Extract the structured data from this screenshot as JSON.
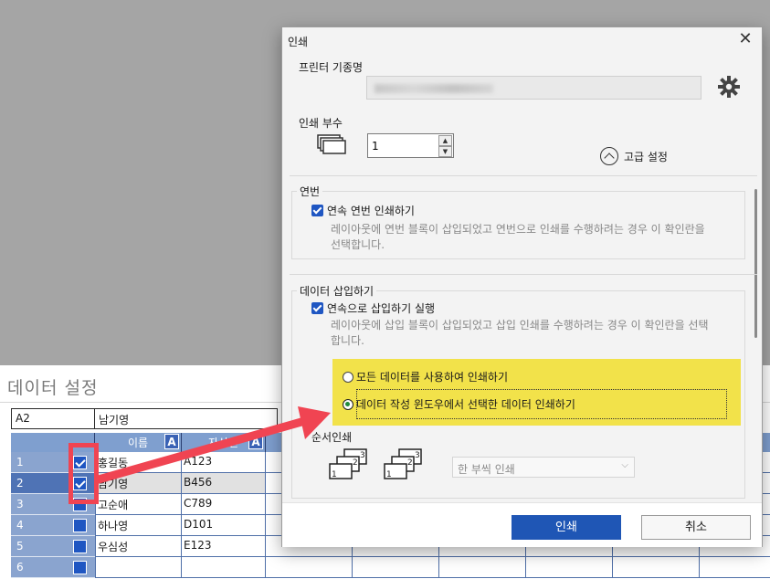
{
  "background": {
    "section_title": "데이터 설정",
    "cell_address": "A2",
    "cell_value": "남기영",
    "column_headers": [
      "이름",
      "자산번"
    ],
    "rows": [
      {
        "num": "1",
        "name": "홍길동",
        "code": "A123",
        "checked": true
      },
      {
        "num": "2",
        "name": "남기영",
        "code": "B456",
        "checked": true
      },
      {
        "num": "3",
        "name": "고순애",
        "code": "C789",
        "checked": false
      },
      {
        "num": "4",
        "name": "하나영",
        "code": "D101",
        "checked": false
      },
      {
        "num": "5",
        "name": "우심성",
        "code": "E123",
        "checked": false
      },
      {
        "num": "6",
        "name": "",
        "code": "",
        "checked": false
      }
    ],
    "badge_letter": "A"
  },
  "dialog": {
    "title": "인쇄",
    "printer_label": "프린터 기종명",
    "copies_label": "인쇄 부수",
    "copies_value": "1",
    "advanced_label": "고급 설정",
    "serial": {
      "group_label": "연번",
      "checkbox_label": "연속 연번 인쇄하기",
      "description": "레이아웃에 연번 블록이 삽입되었고 연번으로 인쇄를 수행하려는 경우 이 확인란을 선택합니다."
    },
    "data_insert": {
      "group_label": "데이터 삽입하기",
      "checkbox_label": "연속으로 삽입하기 실행",
      "description": "레이아웃에 삽입 블록이 삽입되었고 삽입 인쇄를 수행하려는 경우 이 확인란을 선택합니다.",
      "option_all": "모든 데이터를 사용하여 인쇄하기",
      "option_selected": "데이터 작성 윈도우에서 선택한 데이터 인쇄하기",
      "selected_option": "option_selected"
    },
    "sequence": {
      "label": "순서인쇄",
      "select_value": "한 부씩 인쇄"
    },
    "print_button": "인쇄",
    "cancel_button": "취소"
  },
  "colors": {
    "accent": "#1f56b5",
    "highlight": "#f2e24a",
    "annotation_red": "#f04452"
  }
}
